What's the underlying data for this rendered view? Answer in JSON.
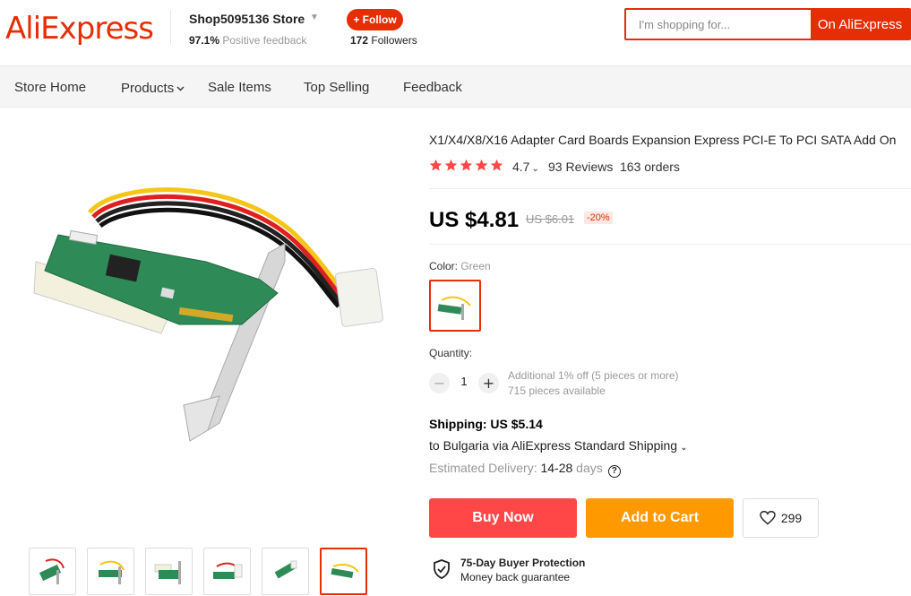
{
  "header": {
    "logo": "AliExpress",
    "store_name": "Shop5095136 Store",
    "feedback_percent": "97.1%",
    "feedback_label": " Positive feedback",
    "follow_label": "+ Follow",
    "followers_count": "172",
    "followers_label": " Followers",
    "search_placeholder": "I'm shopping for...",
    "search_button": "On AliExpress"
  },
  "nav": {
    "items": [
      {
        "label": "Store Home"
      },
      {
        "label": "Products"
      },
      {
        "label": "Sale Items"
      },
      {
        "label": "Top Selling"
      },
      {
        "label": "Feedback"
      }
    ]
  },
  "product": {
    "title": "X1/X4/X8/X16 Adapter Card Boards Expansion Express PCI-E To PCI SATA Add On",
    "rating": "4.7",
    "stars": 5,
    "reviews": "93 Reviews",
    "orders": "163 orders",
    "price": "US $4.81",
    "old_price": "US $6.01",
    "discount": "-20%",
    "color_label": "Color: ",
    "color_value": "Green",
    "quantity_label": "Quantity:",
    "quantity": "1",
    "qty_note1": "Additional 1% off (5 pieces or more)",
    "qty_note2": "715 pieces available",
    "shipping": "Shipping: US $5.14",
    "ship_to": "to Bulgaria via AliExpress Standard Shipping",
    "delivery_label": "Estimated Delivery: ",
    "delivery_value": "14-28",
    "delivery_unit": " days",
    "buy_now": "Buy Now",
    "add_to_cart": "Add to Cart",
    "wishlist_count": "299",
    "protection_title": "75-Day Buyer Protection",
    "protection_sub": "Money back guarantee",
    "thumbnail_count": 6,
    "active_thumbnail": 6
  },
  "colors": {
    "brand": "#e62e04",
    "buy_now": "#ff4747",
    "add_to_cart": "#ff9900",
    "star": "#ff4747",
    "pcb_green": "#2e8b57"
  }
}
